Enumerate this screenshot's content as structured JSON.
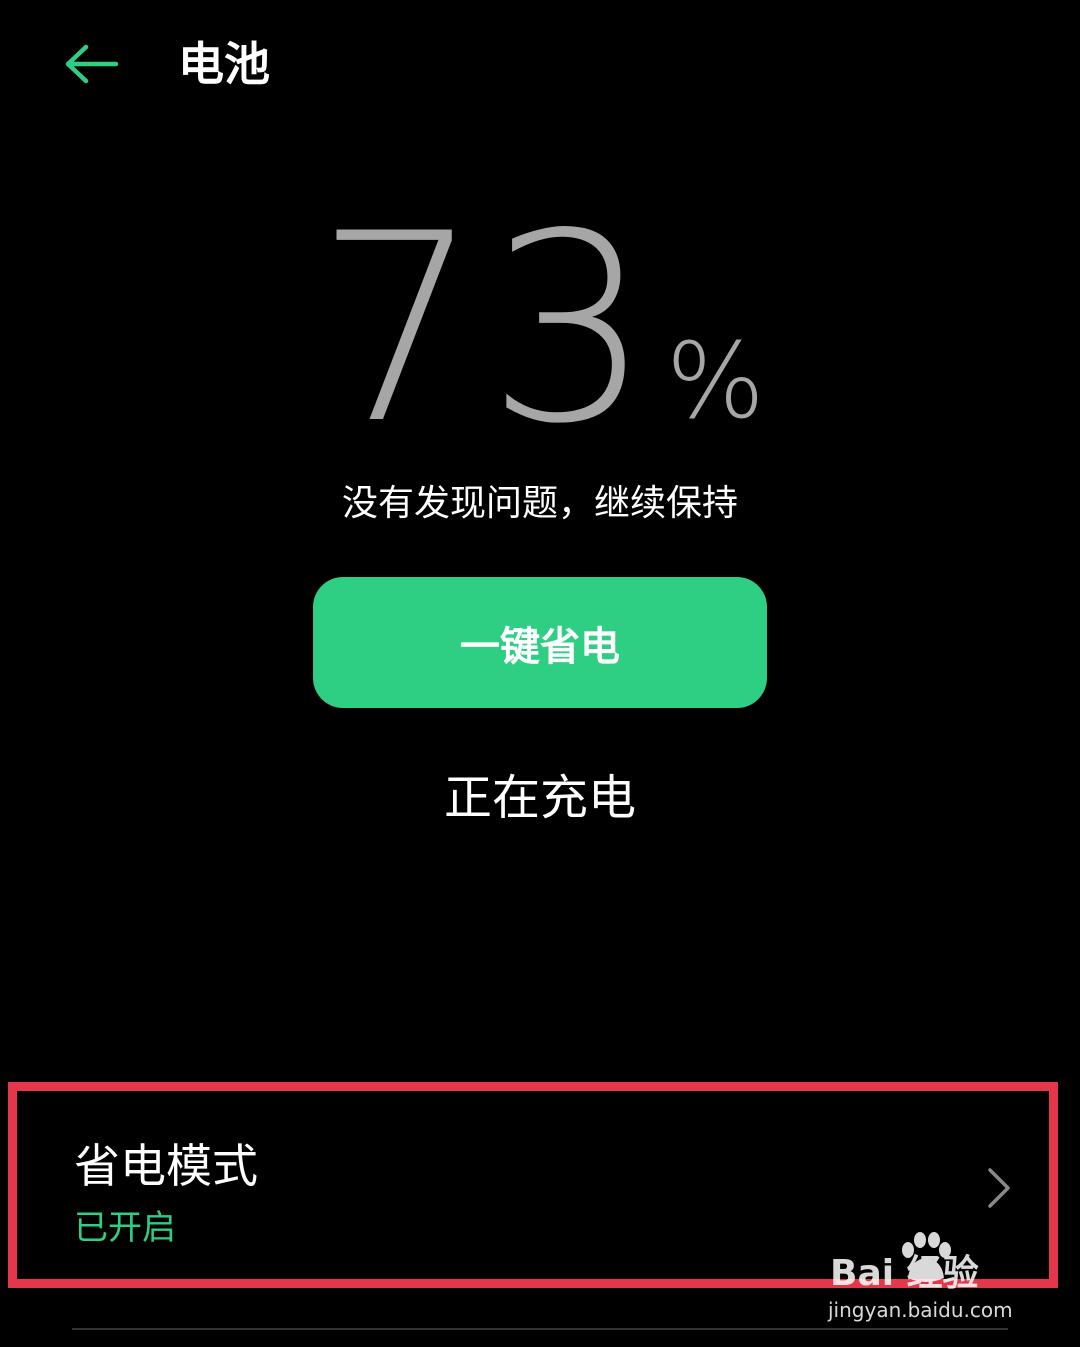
{
  "header": {
    "back_icon": "arrow-left-icon",
    "title": "电池"
  },
  "battery": {
    "level": "73",
    "unit": "%",
    "status": "没有发现问题，继续保持"
  },
  "actions": {
    "one_key_save_label": "一键省电"
  },
  "charging": {
    "label": "正在充电"
  },
  "settings": {
    "power_saving_mode": {
      "title": "省电模式",
      "status": "已开启",
      "chevron_icon": "chevron-right-icon"
    }
  },
  "watermark": {
    "logo_text": "Bai  经验",
    "site": "jingyan.baidu.com"
  },
  "colors": {
    "accent": "#2ecf83",
    "highlight": "#e4374a",
    "background": "#000000",
    "battery_number": "#a6a6a6"
  }
}
